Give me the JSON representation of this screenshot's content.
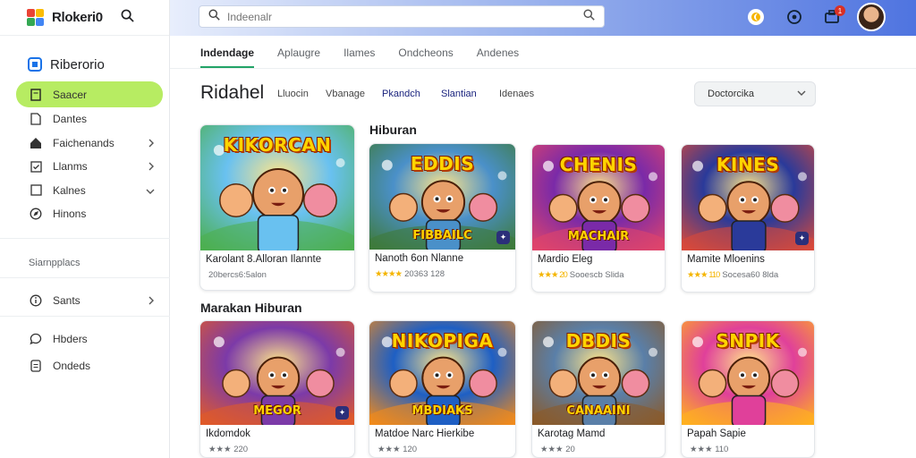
{
  "app": {
    "name": "Rlokeri0"
  },
  "sidebar": {
    "title": "Riberorio",
    "items": [
      {
        "label": "Saacer",
        "icon": "document-icon",
        "active": true,
        "chevron": false
      },
      {
        "label": "Dantes",
        "icon": "file-icon",
        "active": false,
        "chevron": false
      },
      {
        "label": "Faichenands",
        "icon": "home-icon",
        "active": false,
        "chevron": true
      },
      {
        "label": "Llanms",
        "icon": "checklist-icon",
        "active": false,
        "chevron": true
      },
      {
        "label": "Kalnes",
        "icon": "square-icon",
        "active": false,
        "chevron": true
      },
      {
        "label": "Hinons",
        "icon": "compass-icon",
        "active": false,
        "chevron": false
      }
    ],
    "section_label": "Siarnpplacs",
    "items2": [
      {
        "label": "Sants",
        "icon": "info-icon",
        "chevron": true
      }
    ],
    "items3": [
      {
        "label": "Hbders",
        "icon": "chat-icon"
      },
      {
        "label": "Ondeds",
        "icon": "note-icon"
      }
    ]
  },
  "search": {
    "placeholder": "Indeenalr"
  },
  "topbar": {
    "notification_count": "1"
  },
  "tabs": [
    "Indendage",
    "Aplaugre",
    "Ilames",
    "Ondcheons",
    "Andenes"
  ],
  "page_title": "Ridahel",
  "filters": [
    "Lluocin",
    "Vbanage",
    "Pkandch",
    "Slantian",
    "Idenaes"
  ],
  "dropdown": {
    "value": "Doctorcika"
  },
  "sections": {
    "hiburan": "Hiburan",
    "marakan": "Marakan Hiburan"
  },
  "cards": [
    {
      "title": "Karolant 8.Alloran Ilannte",
      "meta": "20bercs6:5alon",
      "stars": "",
      "thumb_title": "KIKORCAN",
      "thumb_sub": "",
      "badge": false,
      "palette": [
        "#69c1f0",
        "#4caf50"
      ]
    },
    {
      "title": "Nanoth 6on Nlanne",
      "meta": "20363 128",
      "stars": "★★★★",
      "thumb_title": "EDDIS",
      "thumb_sub": "FIBBAILC",
      "badge": true,
      "palette": [
        "#4a90c9",
        "#3e7a3a"
      ]
    },
    {
      "title": "Mardio Eleg",
      "meta": "Sooescb Slida",
      "stars": "★★★ 20",
      "thumb_title": "CHENIS",
      "thumb_sub": "MACHAIR",
      "badge": false,
      "palette": [
        "#7a2aa8",
        "#e0446b"
      ]
    },
    {
      "title": "Mamite Mloenins",
      "meta": "Socesa60 8lda",
      "stars": "★★★ 110",
      "thumb_title": "KINES",
      "thumb_sub": "",
      "badge": true,
      "palette": [
        "#2a3a9a",
        "#d84a3a"
      ]
    },
    {
      "title": "Ikdomdok",
      "meta": "★★★ 220",
      "stars": "",
      "thumb_title": "",
      "thumb_sub": "MEGOR",
      "badge": true,
      "palette": [
        "#7c3aa8",
        "#e05a2a"
      ]
    },
    {
      "title": "Matdoe Narc Hierkibe",
      "meta": "★★★ 120",
      "stars": "",
      "thumb_title": "NIKOPIGA",
      "thumb_sub": "MBDIAKS",
      "badge": false,
      "palette": [
        "#1e5fc4",
        "#f08a1c"
      ]
    },
    {
      "title": "Karotag Mamd",
      "meta": "★★★ 20",
      "stars": "",
      "thumb_title": "DBDIS",
      "thumb_sub": "CANAAINI",
      "badge": false,
      "palette": [
        "#5a7fa8",
        "#8a5a2a"
      ]
    },
    {
      "title": "Papah Sapie",
      "meta": "★★★ 110",
      "stars": "",
      "thumb_title": "SNPIK",
      "thumb_sub": "",
      "badge": false,
      "palette": [
        "#e0409a",
        "#ffb020"
      ]
    }
  ]
}
